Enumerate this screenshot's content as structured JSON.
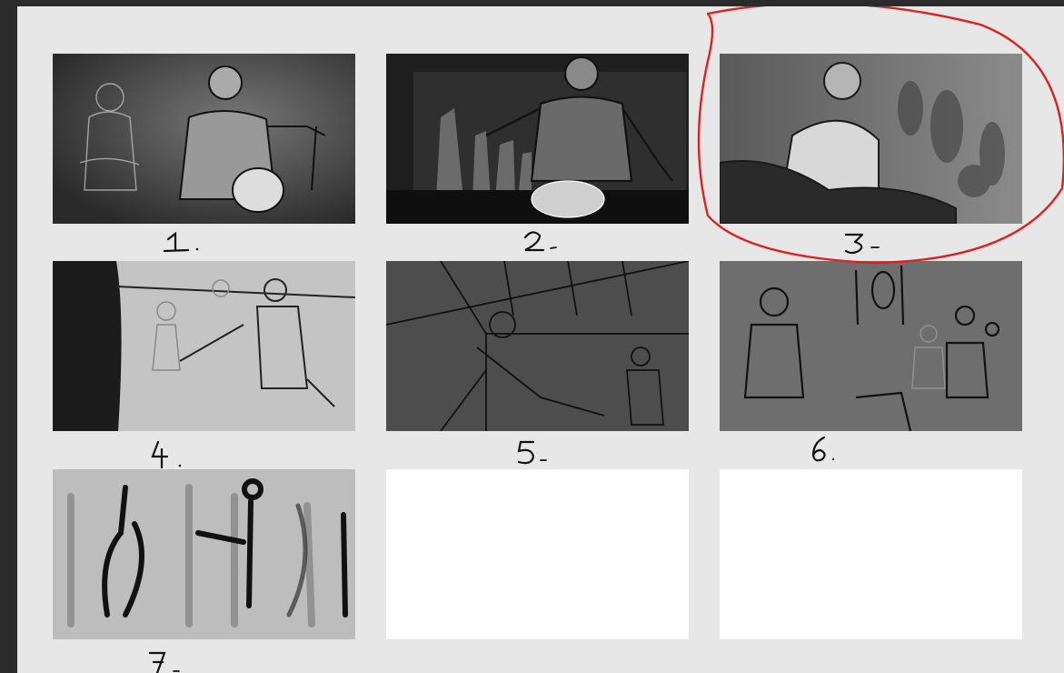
{
  "storyboard": {
    "frames": [
      {
        "number": "1.",
        "state": "sketch",
        "tone": "dark"
      },
      {
        "number": "2.",
        "state": "sketch",
        "tone": "dark"
      },
      {
        "number": "3.",
        "state": "sketch",
        "tone": "medium",
        "highlighted": true
      },
      {
        "number": "4.",
        "state": "sketch",
        "tone": "light"
      },
      {
        "number": "5.",
        "state": "sketch",
        "tone": "medium-dark"
      },
      {
        "number": "6.",
        "state": "sketch",
        "tone": "medium"
      },
      {
        "number": "7.",
        "state": "sketch",
        "tone": "light"
      },
      {
        "number": "",
        "state": "empty"
      },
      {
        "number": "",
        "state": "empty"
      }
    ],
    "highlight_color": "#e02020"
  }
}
